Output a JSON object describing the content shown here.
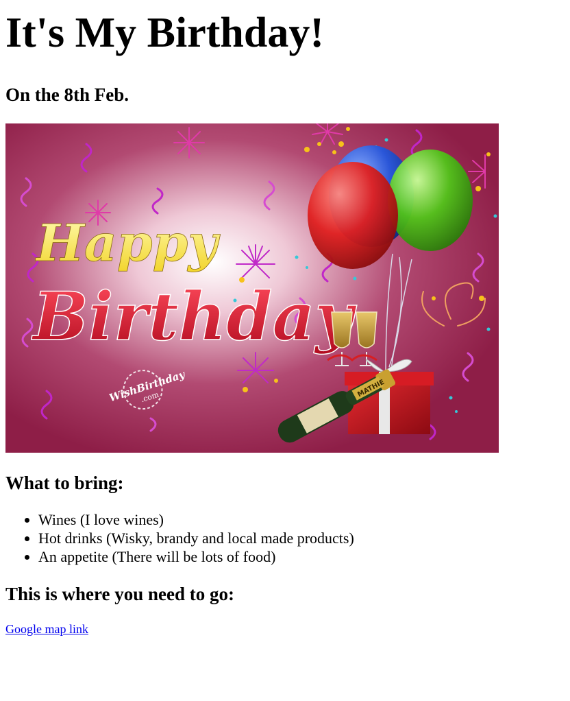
{
  "header": {
    "title": "It's My Birthday!",
    "date_line": "On the 8th Feb."
  },
  "banner": {
    "greeting_line1": "Happy",
    "greeting_line2": "Birthday",
    "watermark_line1": "WishBirthday",
    "watermark_line2": ".com",
    "bottle_label": "MATHIE",
    "colors": {
      "background": "#9c2450",
      "glow": "#ffffff",
      "happy_text": "#f7ef55",
      "birthday_text": "#d8142c",
      "balloon_red": "#d81e22",
      "balloon_blue": "#2a56d8",
      "balloon_green": "#52c41a",
      "gift_box": "#c61720",
      "ribbon": "#e8e8e8"
    }
  },
  "bring": {
    "heading": "What to bring:",
    "items": [
      "Wines (I love wines)",
      "Hot drinks (Wisky, brandy and local made products)",
      "An appetite (There will be lots of food)"
    ]
  },
  "directions": {
    "heading": "This is where you need to go:",
    "link_text": "Google map link"
  }
}
